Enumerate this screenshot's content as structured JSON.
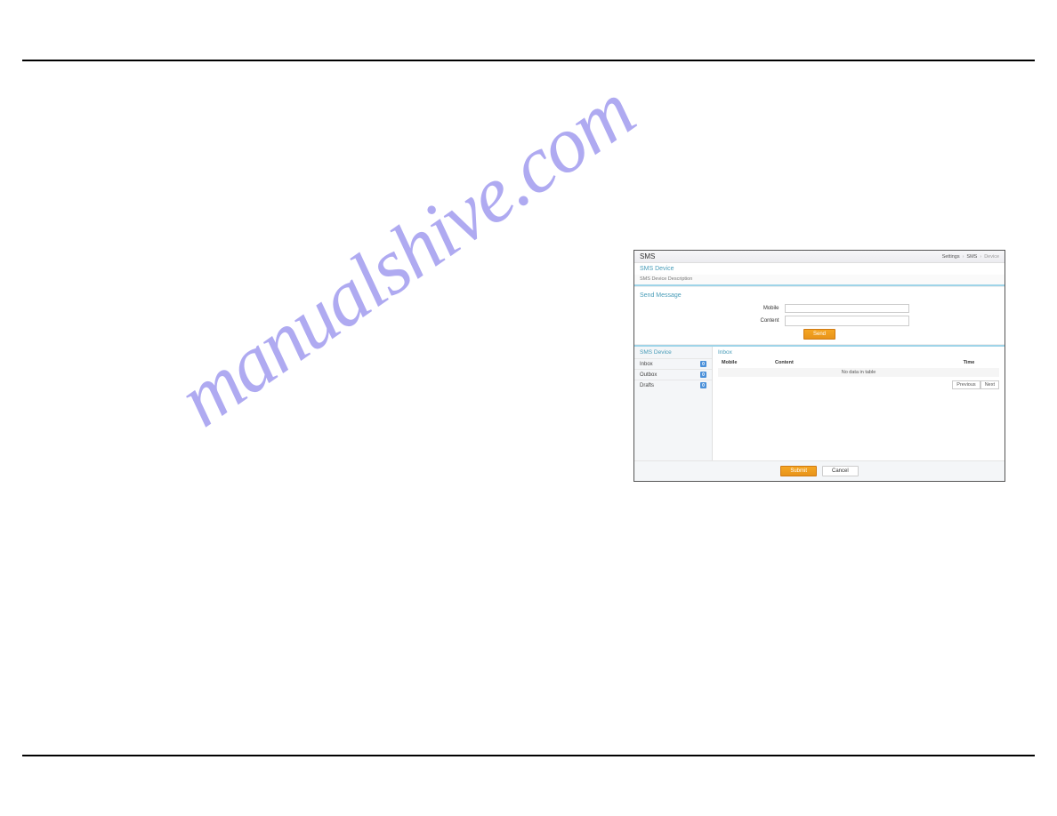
{
  "watermark": "manualshive.com",
  "page_title": "SMS",
  "breadcrumbs": {
    "a": "Settings",
    "b": "SMS",
    "c": "Device"
  },
  "sms_device": {
    "head": "SMS Device",
    "desc": "SMS Device Description"
  },
  "send_message": {
    "head": "Send Message",
    "mobile_label": "Mobile",
    "mobile_value": "",
    "content_label": "Content",
    "content_value": "",
    "send_label": "Send"
  },
  "sidebar": {
    "head": "SMS Device",
    "items": [
      {
        "label": "Inbox",
        "count": "0"
      },
      {
        "label": "Outbox",
        "count": "0"
      },
      {
        "label": "Drafts",
        "count": "0"
      }
    ]
  },
  "inbox": {
    "head": "Inbox",
    "cols": {
      "mobile": "Mobile",
      "content": "Content",
      "time": "Time"
    },
    "empty": "No data in table",
    "prev": "Previous",
    "next": "Next"
  },
  "footer": {
    "submit": "Submit",
    "cancel": "Cancel"
  }
}
